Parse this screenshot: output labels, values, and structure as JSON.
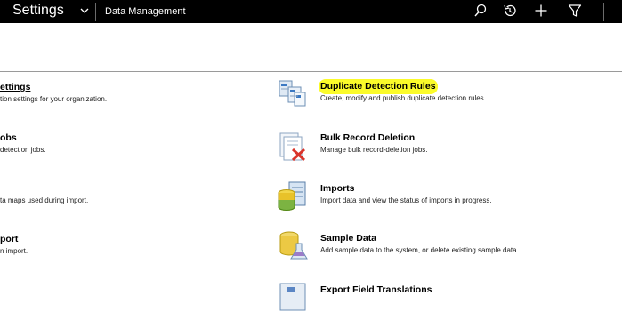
{
  "header": {
    "app_title": "Settings",
    "breadcrumb": "Data Management"
  },
  "left_items": [
    {
      "title": "ettings",
      "description": "tion settings for your organization."
    },
    {
      "title": "obs",
      "description": "detection jobs."
    },
    {
      "title": "",
      "description": "ta maps used during import."
    },
    {
      "title": "port",
      "description": "n import."
    }
  ],
  "right_items": [
    {
      "title": "Duplicate Detection Rules",
      "description": "Create, modify and publish duplicate detection rules.",
      "highlighted": true
    },
    {
      "title": "Bulk Record Deletion",
      "description": "Manage bulk record-deletion jobs."
    },
    {
      "title": "Imports",
      "description": "Import data and view the status of imports in progress."
    },
    {
      "title": "Sample Data",
      "description": "Add sample data to the system, or delete existing sample data."
    },
    {
      "title": "Export Field Translations",
      "description": ""
    }
  ],
  "colors": {
    "topbar": "#000000",
    "highlight": "#fbfb2a"
  }
}
